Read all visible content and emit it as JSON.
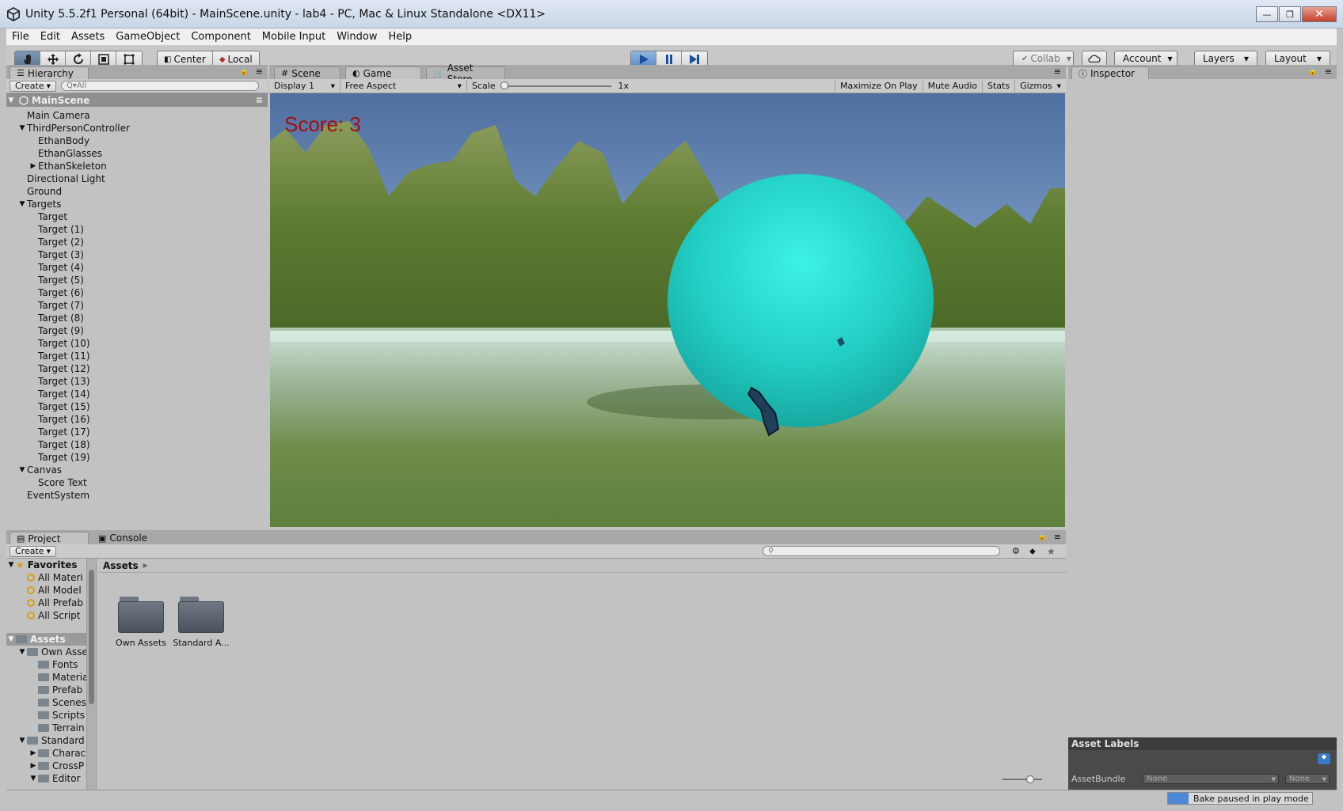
{
  "window": {
    "title": "Unity 5.5.2f1 Personal (64bit) - MainScene.unity - lab4 - PC, Mac & Linux Standalone <DX11>",
    "controls": [
      "—",
      "❐",
      "✕"
    ]
  },
  "menu": [
    "File",
    "Edit",
    "Assets",
    "GameObject",
    "Component",
    "Mobile Input",
    "Window",
    "Help"
  ],
  "toolbar": {
    "pivot_label": "Center",
    "space_label": "Local",
    "collab_label": "Collab",
    "account_label": "Account",
    "layers_label": "Layers",
    "layout_label": "Layout",
    "play_state": "playing"
  },
  "hierarchy": {
    "tab": "Hierarchy",
    "create_label": "Create",
    "search_placeholder": "Q▾All",
    "scene_name": "MainScene",
    "items": [
      {
        "label": "Main Camera",
        "depth": 0,
        "arrow": ""
      },
      {
        "label": "ThirdPersonController",
        "depth": 0,
        "arrow": "▼"
      },
      {
        "label": "EthanBody",
        "depth": 1,
        "arrow": ""
      },
      {
        "label": "EthanGlasses",
        "depth": 1,
        "arrow": ""
      },
      {
        "label": "EthanSkeleton",
        "depth": 1,
        "arrow": "▶"
      },
      {
        "label": "Directional Light",
        "depth": 0,
        "arrow": ""
      },
      {
        "label": "Ground",
        "depth": 0,
        "arrow": ""
      },
      {
        "label": "Targets",
        "depth": 0,
        "arrow": "▼"
      },
      {
        "label": "Target",
        "depth": 1,
        "arrow": ""
      },
      {
        "label": "Target (1)",
        "depth": 1,
        "arrow": ""
      },
      {
        "label": "Target (2)",
        "depth": 1,
        "arrow": ""
      },
      {
        "label": "Target (3)",
        "depth": 1,
        "arrow": ""
      },
      {
        "label": "Target (4)",
        "depth": 1,
        "arrow": ""
      },
      {
        "label": "Target (5)",
        "depth": 1,
        "arrow": ""
      },
      {
        "label": "Target (6)",
        "depth": 1,
        "arrow": ""
      },
      {
        "label": "Target (7)",
        "depth": 1,
        "arrow": ""
      },
      {
        "label": "Target (8)",
        "depth": 1,
        "arrow": ""
      },
      {
        "label": "Target (9)",
        "depth": 1,
        "arrow": ""
      },
      {
        "label": "Target (10)",
        "depth": 1,
        "arrow": ""
      },
      {
        "label": "Target (11)",
        "depth": 1,
        "arrow": ""
      },
      {
        "label": "Target (12)",
        "depth": 1,
        "arrow": ""
      },
      {
        "label": "Target (13)",
        "depth": 1,
        "arrow": ""
      },
      {
        "label": "Target (14)",
        "depth": 1,
        "arrow": ""
      },
      {
        "label": "Target (15)",
        "depth": 1,
        "arrow": ""
      },
      {
        "label": "Target (16)",
        "depth": 1,
        "arrow": ""
      },
      {
        "label": "Target (17)",
        "depth": 1,
        "arrow": ""
      },
      {
        "label": "Target (18)",
        "depth": 1,
        "arrow": ""
      },
      {
        "label": "Target (19)",
        "depth": 1,
        "arrow": ""
      },
      {
        "label": "Canvas",
        "depth": 0,
        "arrow": "▼"
      },
      {
        "label": "Score Text",
        "depth": 1,
        "arrow": ""
      },
      {
        "label": "EventSystem",
        "depth": 0,
        "arrow": ""
      }
    ]
  },
  "center": {
    "tabs": [
      {
        "label": "Scene",
        "icon": "#"
      },
      {
        "label": "Game",
        "icon": "◐"
      },
      {
        "label": "Asset Store",
        "icon": "🛒"
      }
    ],
    "display": "Display 1",
    "aspect": "Free Aspect",
    "scale_label": "Scale",
    "scale_value": "1x",
    "maximize": "Maximize On Play",
    "mute": "Mute Audio",
    "stats": "Stats",
    "gizmos": "Gizmos",
    "score_text": "Score: 3"
  },
  "inspector": {
    "tab": "Inspector",
    "asset_labels": "Asset Labels",
    "assetbundle_label": "AssetBundle",
    "assetbundle_value": "None",
    "variant_value": "None"
  },
  "project": {
    "tabs": [
      {
        "label": "Project",
        "icon": "▤"
      },
      {
        "label": "Console",
        "icon": "▣"
      }
    ],
    "create_label": "Create",
    "favorites_label": "Favorites",
    "favorites": [
      "All Materi",
      "All Model",
      "All Prefab",
      "All Script"
    ],
    "assets_label": "Assets",
    "tree": [
      {
        "label": "Own Asse",
        "depth": 1,
        "arrow": "▼"
      },
      {
        "label": "Fonts",
        "depth": 2,
        "arrow": ""
      },
      {
        "label": "Materia",
        "depth": 2,
        "arrow": ""
      },
      {
        "label": "Prefab",
        "depth": 2,
        "arrow": ""
      },
      {
        "label": "Scenes",
        "depth": 2,
        "arrow": ""
      },
      {
        "label": "Scripts",
        "depth": 2,
        "arrow": ""
      },
      {
        "label": "Terrain",
        "depth": 2,
        "arrow": ""
      },
      {
        "label": "Standard",
        "depth": 1,
        "arrow": "▼"
      },
      {
        "label": "Charac",
        "depth": 2,
        "arrow": "▶"
      },
      {
        "label": "CrossP",
        "depth": 2,
        "arrow": "▶"
      },
      {
        "label": "Editor",
        "depth": 2,
        "arrow": "▼"
      }
    ],
    "breadcrumb": "Assets",
    "folders": [
      "Own Assets",
      "Standard A..."
    ]
  },
  "status": {
    "bake": "Bake paused in play mode"
  }
}
